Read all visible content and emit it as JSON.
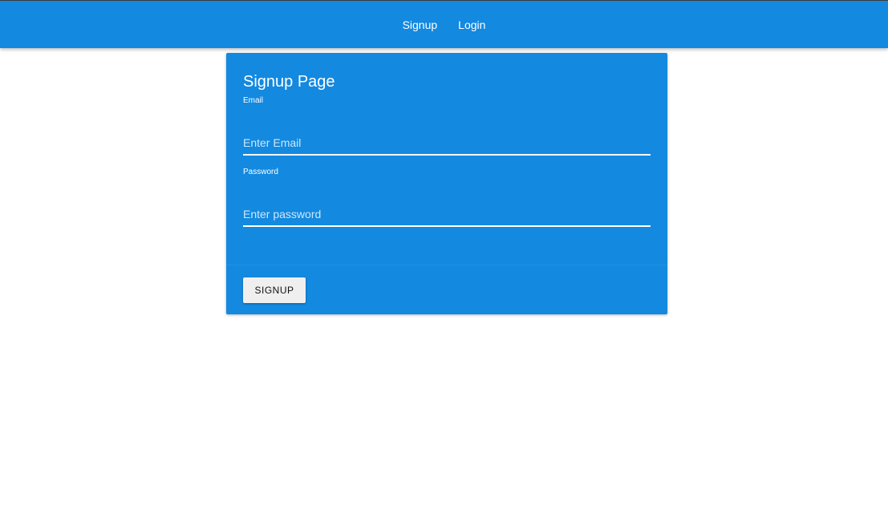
{
  "nav": {
    "links": [
      {
        "label": "Signup"
      },
      {
        "label": "Login"
      }
    ]
  },
  "card": {
    "title": "Signup Page",
    "email": {
      "label": "Email",
      "placeholder": "Enter Email",
      "value": ""
    },
    "password": {
      "label": "Password",
      "placeholder": "Enter password",
      "value": ""
    },
    "submit_label": "SIGNUP"
  },
  "colors": {
    "primary": "#1389e0",
    "button_bg": "#efefef",
    "text_on_primary": "#ffffff"
  }
}
